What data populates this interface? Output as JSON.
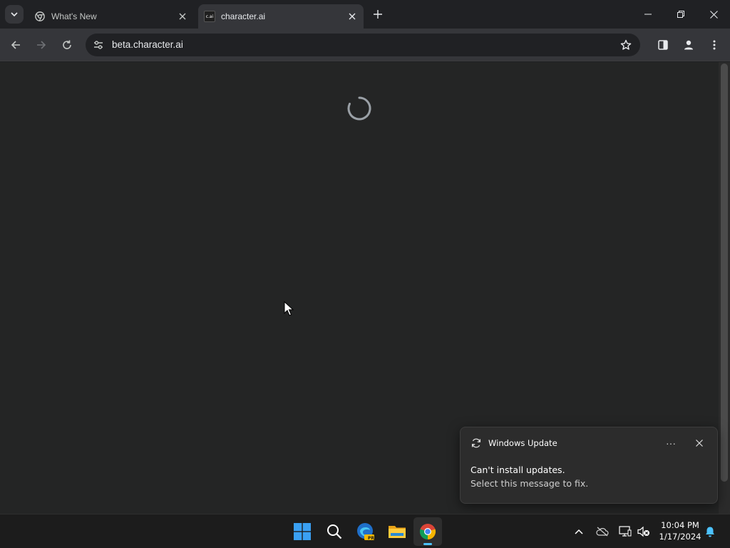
{
  "browser": {
    "tabs": [
      {
        "title": "What's New",
        "favicon": "chrome-icon",
        "active": false
      },
      {
        "title": "character.ai",
        "favicon": "c.ai",
        "active": true
      }
    ],
    "address": "beta.character.ai"
  },
  "page": {
    "state": "loading",
    "spinner_color": "#9aa0a6"
  },
  "notification": {
    "app": "Windows Update",
    "title": "Can't install updates.",
    "body": "Select this message to fix.",
    "more_label": "···"
  },
  "taskbar": {
    "apps": [
      "start-icon",
      "search-icon",
      "edge-preview-icon",
      "file-explorer-icon",
      "chrome-icon"
    ],
    "edge_badge": "PRE",
    "time": "10:04 PM",
    "date": "1/17/2024"
  },
  "colors": {
    "accent": "#4cc2ff",
    "background": "#242525",
    "toolbar": "#35363a"
  }
}
